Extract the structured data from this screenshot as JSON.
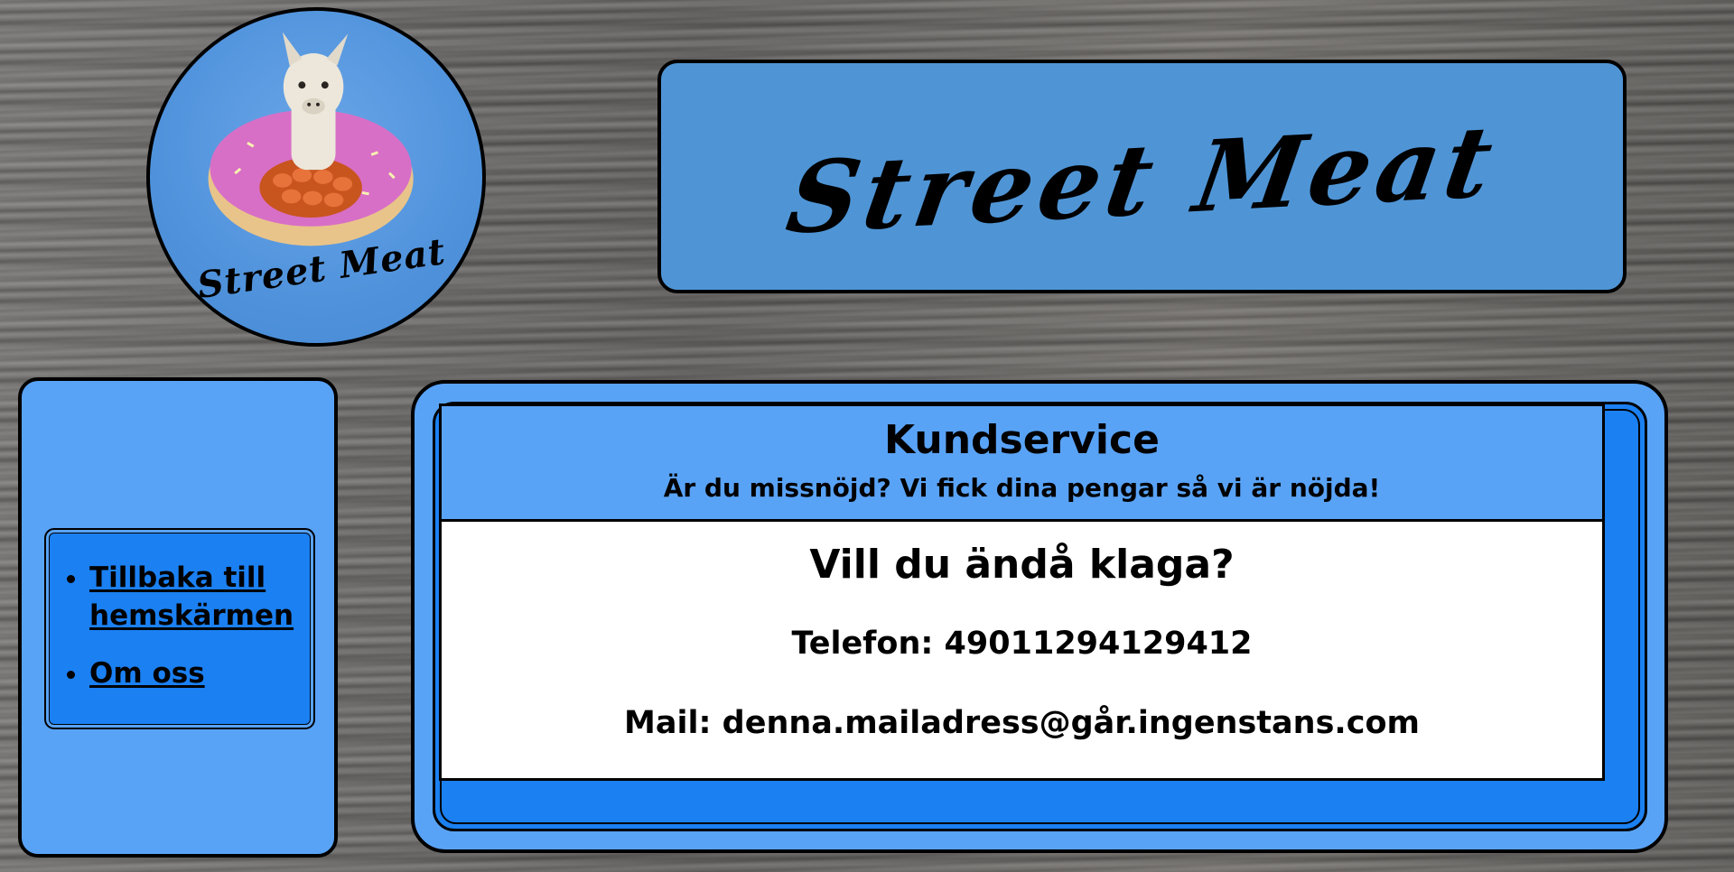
{
  "brand": {
    "logo_text": "Street Meat",
    "title": "Street Meat"
  },
  "nav": {
    "items": [
      {
        "label": "Tillbaka till hemskärmen"
      },
      {
        "label": "Om oss"
      }
    ]
  },
  "main": {
    "title": "Kundservice",
    "subtitle": "Är du missnöjd? Vi fick dina pengar så vi är nöjda!",
    "question": "Vill du ändå klaga?",
    "phone": "Telefon: 49011294129412",
    "mail": "Mail: denna.mailadress@går.ingenstans.com"
  },
  "colors": {
    "banner_blue": "#4f95d6",
    "panel_blue": "#59a3f7",
    "accent_blue": "#1b80f2",
    "card_white": "#ffffff",
    "border_black": "#000000"
  },
  "icons": [
    "llama-donut-logo-image"
  ]
}
